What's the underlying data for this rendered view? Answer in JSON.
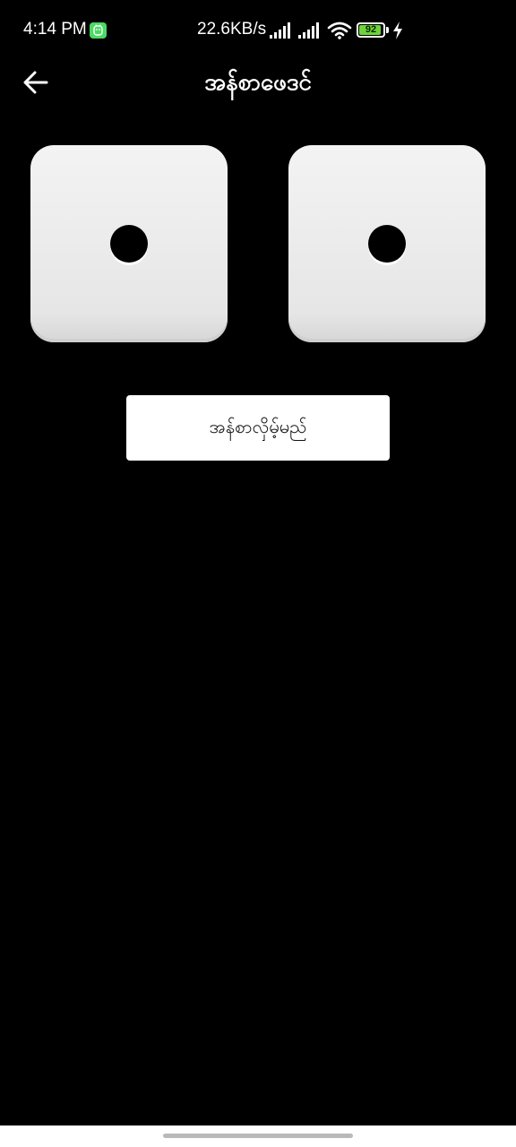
{
  "status_bar": {
    "time": "4:14 PM",
    "net_speed": "22.6KB/s",
    "battery_level": "92",
    "battery_percent": 92,
    "icons": [
      "app-notification-icon",
      "signal-icon",
      "signal-icon",
      "wifi-icon",
      "battery-icon",
      "charging-icon"
    ]
  },
  "app_bar": {
    "back_icon": "arrow-left-icon",
    "title": "အန်စာဖေဒင်"
  },
  "dice": [
    {
      "value": 1
    },
    {
      "value": 1
    }
  ],
  "actions": {
    "roll_label": "အန်စာလှိမ့်မည်"
  },
  "colors": {
    "background": "#000000",
    "die_face": "#eeeeee",
    "button": "#ffffff",
    "battery_fill": "#6fd43a",
    "app_badge": "#4cd964"
  }
}
